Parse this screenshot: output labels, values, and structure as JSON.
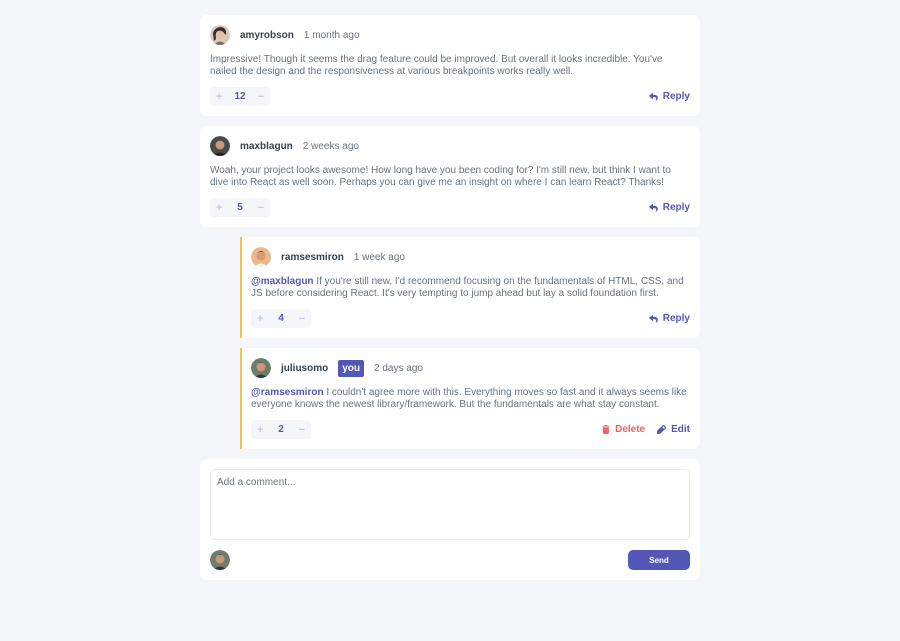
{
  "comments": [
    {
      "username": "amyrobson",
      "time": "1 month ago",
      "text": "Impressive! Though it seems the drag feature could be improved. But overall it looks incredible. You've nailed the design and the responsiveness at various breakpoints works really well.",
      "score": "12",
      "reply_label": "Reply"
    },
    {
      "username": "maxblagun",
      "time": "2 weeks ago",
      "text": "Woah, your project looks awesome! How long have you been coding for? I'm still new, but think I want to dive into React as well soon. Perhaps you can give me an insight on where I can learn React? Thanks!",
      "score": "5",
      "reply_label": "Reply"
    }
  ],
  "replies": [
    {
      "username": "ramsesmiron",
      "time": "1 week ago",
      "mention": "@maxblagun",
      "text": " If you're still new, I'd recommend focusing on the fundamentals of HTML, CSS, and JS before considering React. It's very tempting to jump ahead but lay a solid foundation first.",
      "score": "4",
      "reply_label": "Reply"
    },
    {
      "username": "juliusomo",
      "you_badge": "you",
      "time": "2 days ago",
      "mention": "@ramsesmiron",
      "text": " I couldn't agree more with this. Everything moves so fast and it always seems like everyone knows the newest library/framework. But the fundamentals are what stay constant.",
      "score": "2",
      "delete_label": "Delete",
      "edit_label": "Edit"
    }
  ],
  "vote": {
    "plus": "+",
    "minus": "−"
  },
  "compose": {
    "placeholder": "Add a comment...",
    "send_label": "Send"
  },
  "colors": {
    "accent": "#5357b6",
    "danger": "#ed6368",
    "thread_line": "#f5c34b"
  },
  "icons": {
    "reply": "reply-arrow-icon",
    "delete": "trash-icon",
    "edit": "pencil-icon"
  }
}
